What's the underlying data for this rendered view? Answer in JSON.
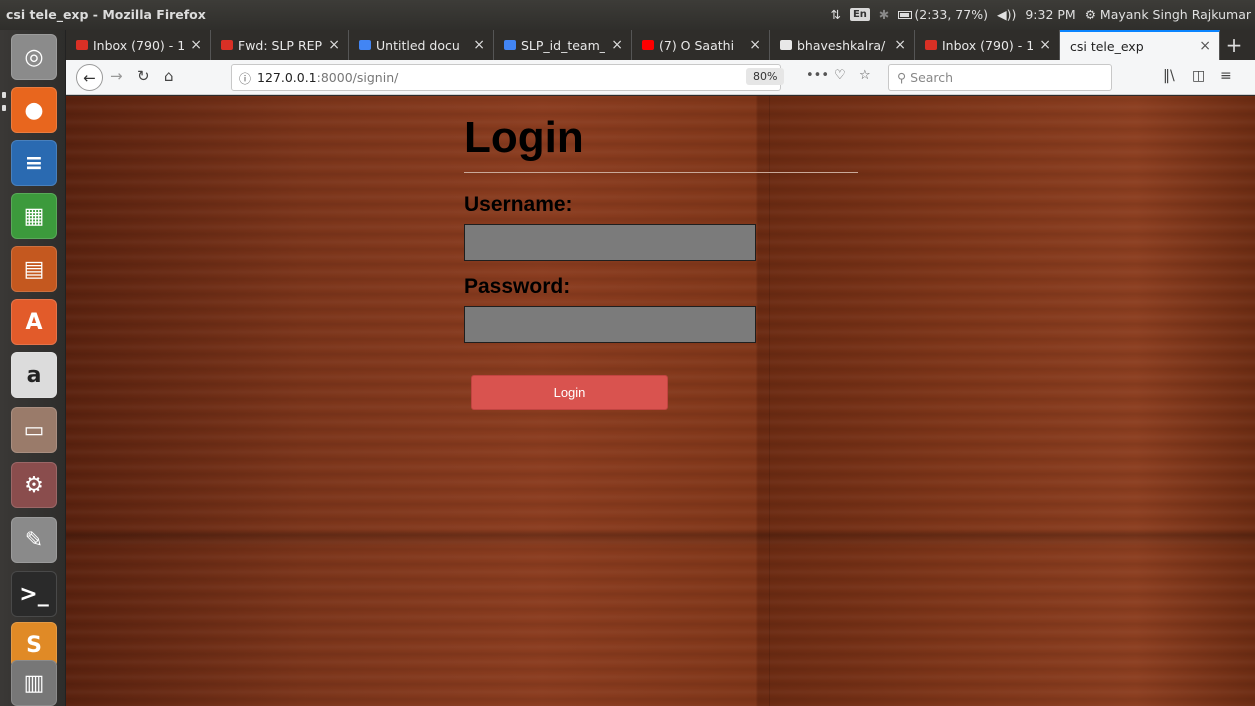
{
  "top_panel": {
    "window_title": "csi tele_exp - Mozilla Firefox",
    "keyboard": "En",
    "battery": "(2:33, 77%)",
    "time": "9:32 PM",
    "user": "Mayank Singh Rajkumar"
  },
  "launcher": {
    "items": [
      {
        "name": "ubuntu-dash-icon",
        "glyph": "◎",
        "color": "#8b8b8b"
      },
      {
        "name": "firefox-icon",
        "glyph": "●",
        "color": "#e8661e"
      },
      {
        "name": "libreoffice-writer-icon",
        "glyph": "≡",
        "color": "#2a6ab1"
      },
      {
        "name": "libreoffice-calc-icon",
        "glyph": "▦",
        "color": "#3c9a3c"
      },
      {
        "name": "libreoffice-impress-icon",
        "glyph": "▤",
        "color": "#c4581f"
      },
      {
        "name": "software-center-icon",
        "glyph": "A",
        "color": "#e25b2a"
      },
      {
        "name": "amazon-icon",
        "glyph": "a",
        "color": "#dcdcdc"
      },
      {
        "name": "file-manager-icon",
        "glyph": "▭",
        "color": "#9a7b6a"
      },
      {
        "name": "system-settings-icon",
        "glyph": "⚙",
        "color": "#8a4d4d"
      },
      {
        "name": "text-editor-icon",
        "glyph": "✎",
        "color": "#8a8a8a"
      },
      {
        "name": "terminal-icon",
        "glyph": ">_",
        "color": "#2a2a2a"
      },
      {
        "name": "sublime-text-icon",
        "glyph": "S",
        "color": "#e08a26"
      },
      {
        "name": "workspaces-icon",
        "glyph": "▥",
        "color": "#777777"
      }
    ]
  },
  "tabs": [
    {
      "label": "Inbox (790) - 1",
      "favicon_color": "#d93025",
      "active": false
    },
    {
      "label": "Fwd: SLP REP(",
      "favicon_color": "#d93025",
      "active": false
    },
    {
      "label": "Untitled docu",
      "favicon_color": "#4285f4",
      "active": false
    },
    {
      "label": "SLP_id_team_",
      "favicon_color": "#4285f4",
      "active": false
    },
    {
      "label": "(7) O Saathi",
      "favicon_color": "#ff0000",
      "active": false
    },
    {
      "label": "bhaveshkalra/",
      "favicon_color": "#e8e8e8",
      "active": false
    },
    {
      "label": "Inbox (790) - 1",
      "favicon_color": "#d93025",
      "active": false
    },
    {
      "label": "csi tele_exp",
      "favicon_color": "",
      "active": true
    }
  ],
  "navbar": {
    "url_host": "127.0.0.1",
    "url_path": ":8000/signin/",
    "zoom": "80%",
    "search_placeholder": "Search"
  },
  "login": {
    "title": "Login",
    "username_label": "Username:",
    "username_value": "",
    "password_label": "Password:",
    "password_value": "",
    "button_label": "Login"
  }
}
